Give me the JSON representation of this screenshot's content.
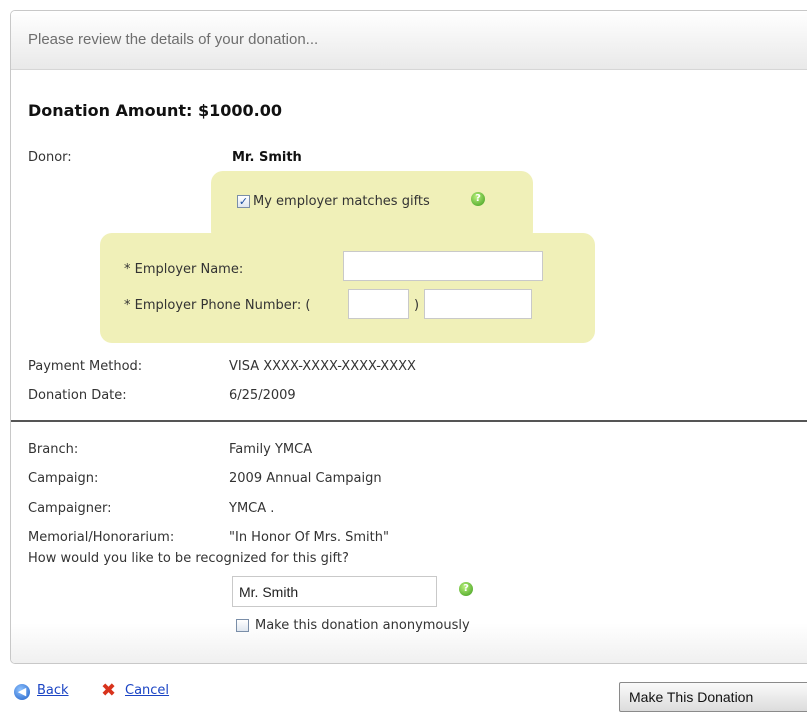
{
  "header": {
    "title": "Please review the details of your donation..."
  },
  "donation": {
    "amount_label": "Donation Amount: $1000.00"
  },
  "donor": {
    "label": "Donor:",
    "value": "Mr. Smith"
  },
  "employer": {
    "matches_label": "My employer matches gifts",
    "matches_checked": true,
    "name_label": "* Employer Name:",
    "name_value": "",
    "phone_label": "* Employer Phone Number: (",
    "phone_paren_close": ")",
    "phone_area_value": "",
    "phone_number_value": ""
  },
  "payment": {
    "method_label": "Payment Method:",
    "method_value": "VISA XXXX-XXXX-XXXX-XXXX",
    "date_label": "Donation Date:",
    "date_value": "6/25/2009"
  },
  "details": {
    "branch_label": "Branch:",
    "branch_value": "Family YMCA",
    "campaign_label": "Campaign:",
    "campaign_value": "2009 Annual Campaign",
    "campaigner_label": "Campaigner:",
    "campaigner_value": "YMCA .",
    "memorial_label": "Memorial/Honorarium:",
    "memorial_value": "\"In Honor Of Mrs. Smith\""
  },
  "recognition": {
    "question": "How would you like to be recognized for this gift?",
    "name_value": "Mr. Smith",
    "anonymous_label": "Make this donation anonymously",
    "anonymous_checked": false
  },
  "footer": {
    "back_label": "Back",
    "cancel_label": "Cancel",
    "submit_label": "Make This Donation"
  },
  "colors": {
    "highlight_panel": "#f0f0b8",
    "link": "#1a44c4",
    "help_icon": "#3c9a1c"
  },
  "icons": {
    "help": "help-icon",
    "back": "back-arrow-icon",
    "cancel": "cancel-x-icon"
  }
}
